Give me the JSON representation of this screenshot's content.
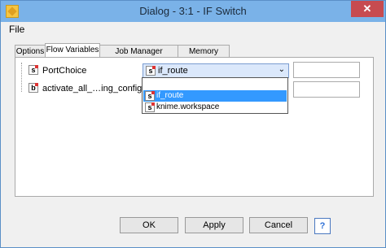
{
  "window": {
    "title": "Dialog - 3:1 - IF Switch",
    "close_glyph": "✕"
  },
  "menu": {
    "file": "File"
  },
  "tabs": [
    {
      "label": "Options"
    },
    {
      "label": "Flow Variables"
    },
    {
      "label": "Job Manager Selection"
    },
    {
      "label": "Memory Policy"
    }
  ],
  "variables": [
    {
      "icon_letter": "s",
      "name": "PortChoice"
    },
    {
      "icon_letter": "b",
      "name": "activate_all_…ing_configure"
    }
  ],
  "combo": {
    "icon_letter": "s",
    "value": "if_route"
  },
  "dropdown": {
    "options": [
      {
        "icon_letter": "",
        "label": ""
      },
      {
        "icon_letter": "s",
        "label": "if_route"
      },
      {
        "icon_letter": "s",
        "label": "knime.workspace"
      }
    ]
  },
  "buttons": {
    "ok": "OK",
    "apply": "Apply",
    "cancel": "Cancel",
    "help": "?"
  }
}
